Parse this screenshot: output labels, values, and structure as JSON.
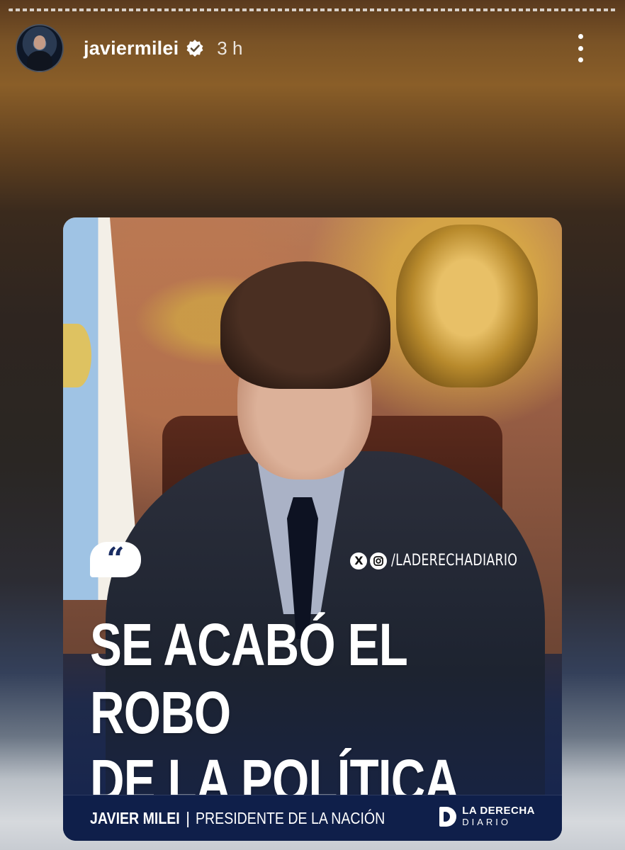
{
  "story": {
    "username": "javiermilei",
    "time": "3 h",
    "verified_icon": "verified-badge-icon",
    "more_icon": "more-options-icon"
  },
  "post": {
    "quote_mark": "“",
    "social_handle": "/LADERECHADIARIO",
    "social_icons": [
      "x-icon",
      "instagram-icon"
    ],
    "headline_line1": "SE ACABÓ EL ROBO",
    "headline_line2": "DE LA POLÍTICA",
    "author_name": "JAVIER MILEI",
    "separator": "|",
    "author_role": "PRESIDENTE DE LA NACIÓN",
    "brand_line1": "LA DERECHA",
    "brand_line2": "DIARIO"
  },
  "colors": {
    "footer_bg": "#0f1f4a",
    "quote_color": "#1a2d63"
  }
}
